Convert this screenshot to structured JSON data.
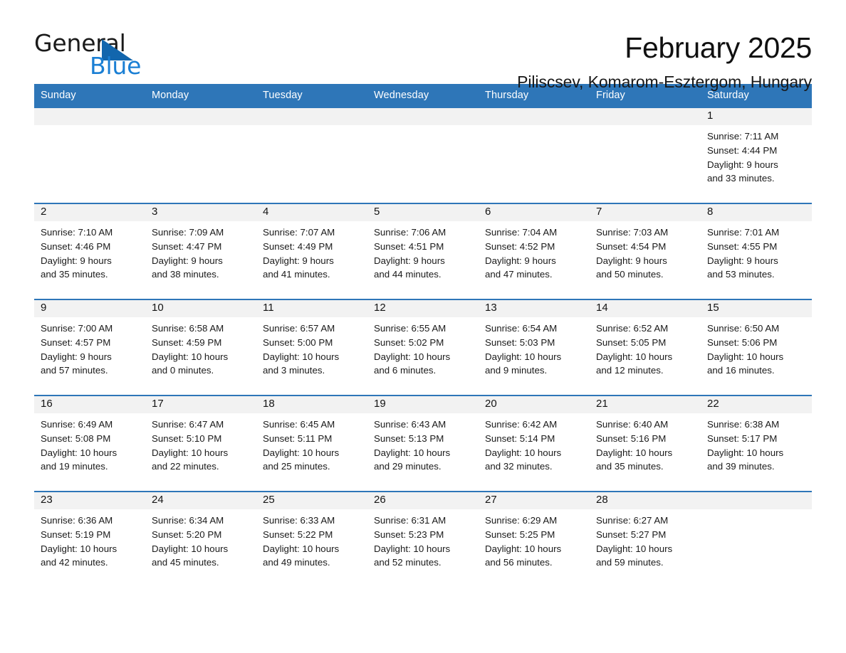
{
  "brand": {
    "name_part1": "General",
    "name_part2": "Blue",
    "accent_color": "#1a7fd4",
    "triangle_color": "#1266ad"
  },
  "header": {
    "month_title": "February 2025",
    "location": "Piliscsev, Komarom-Esztergom, Hungary",
    "header_bg": "#2e76b8"
  },
  "weekday_headers": [
    "Sunday",
    "Monday",
    "Tuesday",
    "Wednesday",
    "Thursday",
    "Friday",
    "Saturday"
  ],
  "weeks": [
    [
      {
        "day": "",
        "sunrise": "",
        "sunset": "",
        "daylight1": "",
        "daylight2": ""
      },
      {
        "day": "",
        "sunrise": "",
        "sunset": "",
        "daylight1": "",
        "daylight2": ""
      },
      {
        "day": "",
        "sunrise": "",
        "sunset": "",
        "daylight1": "",
        "daylight2": ""
      },
      {
        "day": "",
        "sunrise": "",
        "sunset": "",
        "daylight1": "",
        "daylight2": ""
      },
      {
        "day": "",
        "sunrise": "",
        "sunset": "",
        "daylight1": "",
        "daylight2": ""
      },
      {
        "day": "",
        "sunrise": "",
        "sunset": "",
        "daylight1": "",
        "daylight2": ""
      },
      {
        "day": "1",
        "sunrise": "Sunrise: 7:11 AM",
        "sunset": "Sunset: 4:44 PM",
        "daylight1": "Daylight: 9 hours",
        "daylight2": "and 33 minutes."
      }
    ],
    [
      {
        "day": "2",
        "sunrise": "Sunrise: 7:10 AM",
        "sunset": "Sunset: 4:46 PM",
        "daylight1": "Daylight: 9 hours",
        "daylight2": "and 35 minutes."
      },
      {
        "day": "3",
        "sunrise": "Sunrise: 7:09 AM",
        "sunset": "Sunset: 4:47 PM",
        "daylight1": "Daylight: 9 hours",
        "daylight2": "and 38 minutes."
      },
      {
        "day": "4",
        "sunrise": "Sunrise: 7:07 AM",
        "sunset": "Sunset: 4:49 PM",
        "daylight1": "Daylight: 9 hours",
        "daylight2": "and 41 minutes."
      },
      {
        "day": "5",
        "sunrise": "Sunrise: 7:06 AM",
        "sunset": "Sunset: 4:51 PM",
        "daylight1": "Daylight: 9 hours",
        "daylight2": "and 44 minutes."
      },
      {
        "day": "6",
        "sunrise": "Sunrise: 7:04 AM",
        "sunset": "Sunset: 4:52 PM",
        "daylight1": "Daylight: 9 hours",
        "daylight2": "and 47 minutes."
      },
      {
        "day": "7",
        "sunrise": "Sunrise: 7:03 AM",
        "sunset": "Sunset: 4:54 PM",
        "daylight1": "Daylight: 9 hours",
        "daylight2": "and 50 minutes."
      },
      {
        "day": "8",
        "sunrise": "Sunrise: 7:01 AM",
        "sunset": "Sunset: 4:55 PM",
        "daylight1": "Daylight: 9 hours",
        "daylight2": "and 53 minutes."
      }
    ],
    [
      {
        "day": "9",
        "sunrise": "Sunrise: 7:00 AM",
        "sunset": "Sunset: 4:57 PM",
        "daylight1": "Daylight: 9 hours",
        "daylight2": "and 57 minutes."
      },
      {
        "day": "10",
        "sunrise": "Sunrise: 6:58 AM",
        "sunset": "Sunset: 4:59 PM",
        "daylight1": "Daylight: 10 hours",
        "daylight2": "and 0 minutes."
      },
      {
        "day": "11",
        "sunrise": "Sunrise: 6:57 AM",
        "sunset": "Sunset: 5:00 PM",
        "daylight1": "Daylight: 10 hours",
        "daylight2": "and 3 minutes."
      },
      {
        "day": "12",
        "sunrise": "Sunrise: 6:55 AM",
        "sunset": "Sunset: 5:02 PM",
        "daylight1": "Daylight: 10 hours",
        "daylight2": "and 6 minutes."
      },
      {
        "day": "13",
        "sunrise": "Sunrise: 6:54 AM",
        "sunset": "Sunset: 5:03 PM",
        "daylight1": "Daylight: 10 hours",
        "daylight2": "and 9 minutes."
      },
      {
        "day": "14",
        "sunrise": "Sunrise: 6:52 AM",
        "sunset": "Sunset: 5:05 PM",
        "daylight1": "Daylight: 10 hours",
        "daylight2": "and 12 minutes."
      },
      {
        "day": "15",
        "sunrise": "Sunrise: 6:50 AM",
        "sunset": "Sunset: 5:06 PM",
        "daylight1": "Daylight: 10 hours",
        "daylight2": "and 16 minutes."
      }
    ],
    [
      {
        "day": "16",
        "sunrise": "Sunrise: 6:49 AM",
        "sunset": "Sunset: 5:08 PM",
        "daylight1": "Daylight: 10 hours",
        "daylight2": "and 19 minutes."
      },
      {
        "day": "17",
        "sunrise": "Sunrise: 6:47 AM",
        "sunset": "Sunset: 5:10 PM",
        "daylight1": "Daylight: 10 hours",
        "daylight2": "and 22 minutes."
      },
      {
        "day": "18",
        "sunrise": "Sunrise: 6:45 AM",
        "sunset": "Sunset: 5:11 PM",
        "daylight1": "Daylight: 10 hours",
        "daylight2": "and 25 minutes."
      },
      {
        "day": "19",
        "sunrise": "Sunrise: 6:43 AM",
        "sunset": "Sunset: 5:13 PM",
        "daylight1": "Daylight: 10 hours",
        "daylight2": "and 29 minutes."
      },
      {
        "day": "20",
        "sunrise": "Sunrise: 6:42 AM",
        "sunset": "Sunset: 5:14 PM",
        "daylight1": "Daylight: 10 hours",
        "daylight2": "and 32 minutes."
      },
      {
        "day": "21",
        "sunrise": "Sunrise: 6:40 AM",
        "sunset": "Sunset: 5:16 PM",
        "daylight1": "Daylight: 10 hours",
        "daylight2": "and 35 minutes."
      },
      {
        "day": "22",
        "sunrise": "Sunrise: 6:38 AM",
        "sunset": "Sunset: 5:17 PM",
        "daylight1": "Daylight: 10 hours",
        "daylight2": "and 39 minutes."
      }
    ],
    [
      {
        "day": "23",
        "sunrise": "Sunrise: 6:36 AM",
        "sunset": "Sunset: 5:19 PM",
        "daylight1": "Daylight: 10 hours",
        "daylight2": "and 42 minutes."
      },
      {
        "day": "24",
        "sunrise": "Sunrise: 6:34 AM",
        "sunset": "Sunset: 5:20 PM",
        "daylight1": "Daylight: 10 hours",
        "daylight2": "and 45 minutes."
      },
      {
        "day": "25",
        "sunrise": "Sunrise: 6:33 AM",
        "sunset": "Sunset: 5:22 PM",
        "daylight1": "Daylight: 10 hours",
        "daylight2": "and 49 minutes."
      },
      {
        "day": "26",
        "sunrise": "Sunrise: 6:31 AM",
        "sunset": "Sunset: 5:23 PM",
        "daylight1": "Daylight: 10 hours",
        "daylight2": "and 52 minutes."
      },
      {
        "day": "27",
        "sunrise": "Sunrise: 6:29 AM",
        "sunset": "Sunset: 5:25 PM",
        "daylight1": "Daylight: 10 hours",
        "daylight2": "and 56 minutes."
      },
      {
        "day": "28",
        "sunrise": "Sunrise: 6:27 AM",
        "sunset": "Sunset: 5:27 PM",
        "daylight1": "Daylight: 10 hours",
        "daylight2": "and 59 minutes."
      },
      {
        "day": "",
        "sunrise": "",
        "sunset": "",
        "daylight1": "",
        "daylight2": ""
      }
    ]
  ]
}
